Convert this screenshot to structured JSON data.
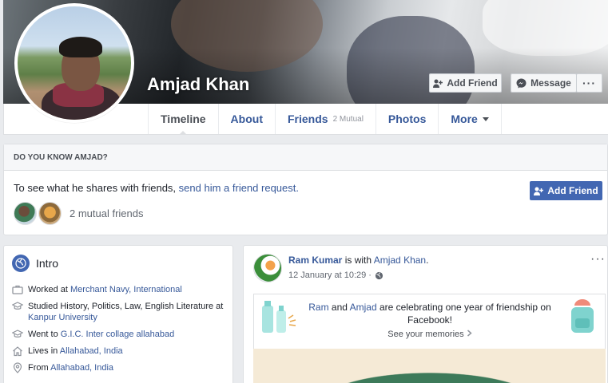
{
  "profile": {
    "name": "Amjad Khan"
  },
  "actions": {
    "add_friend": "Add Friend",
    "message": "Message",
    "more_dots": "···"
  },
  "tabs": [
    {
      "label": "Timeline"
    },
    {
      "label": "About"
    },
    {
      "label": "Friends",
      "sub": "2 Mutual"
    },
    {
      "label": "Photos"
    },
    {
      "label": "More"
    }
  ],
  "know": {
    "heading": "DO YOU KNOW AMJAD?",
    "text": "To see what he shares with friends, ",
    "link": "send him a friend request.",
    "button": "Add Friend",
    "mutual": "2 mutual friends"
  },
  "intro": {
    "title": "Intro",
    "items": [
      {
        "icon": "briefcase-icon",
        "prefix": "Worked at ",
        "link": "Merchant Navy, International"
      },
      {
        "icon": "graduation-cap-icon",
        "prefix": "Studied History, Politics, Law, English Literature at ",
        "link": "Kanpur University"
      },
      {
        "icon": "graduation-cap-icon",
        "prefix": "Went to ",
        "link": "G.I.C. Inter collage allahabad"
      },
      {
        "icon": "home-icon",
        "prefix": "Lives in ",
        "link": "Allahabad, India"
      },
      {
        "icon": "location-pin-icon",
        "prefix": "From ",
        "link": "Allahabad, India"
      }
    ]
  },
  "post": {
    "author": "Ram Kumar",
    "with_text": " is with ",
    "tagged": "Amjad Khan",
    "period": ".",
    "time": "12 January at 10:29 ·",
    "dots": "···",
    "memory": {
      "name1": "Ram",
      "and": " and ",
      "name2": "Amjad",
      "text": " are celebrating one year of friendship on Facebook!",
      "see": "See your memories"
    }
  }
}
